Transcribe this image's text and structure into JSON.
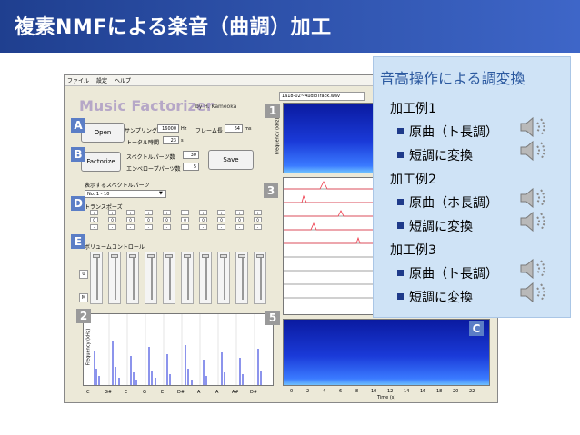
{
  "slide_title": "複素NMFによる楽音（曲調）加工",
  "app": {
    "menu": [
      "ファイル",
      "設定",
      "ヘルプ"
    ],
    "title": "Music Factorizer",
    "author": "by H. Kameoka",
    "file_name": "1a18-02~AudioTrack.wav",
    "open_label": "Open",
    "factorize_label": "Factorize",
    "save_label": "Save",
    "sampling_label": "サンプリング",
    "sampling_value": "16000",
    "sampling_unit": "Hz",
    "frame_label": "フレーム長",
    "frame_value": "64",
    "frame_unit": "ms",
    "total_time_label": "トータル時間",
    "total_time_value": "23",
    "total_time_unit": "s",
    "spectral_parts_label": "スペクトルパーツ数",
    "spectral_parts_value": "30",
    "envelope_parts_label": "エンベロープパーツ数",
    "envelope_parts_value": "5",
    "display_label": "表示するスペクトルパーツ",
    "display_select": "No. 1 - 10",
    "transpose_label": "トランスポーズ",
    "volume_label": "ボリュームコントロール",
    "transpose_values": [
      "0",
      "0",
      "0",
      "0",
      "0",
      "0",
      "0",
      "0",
      "0",
      "0"
    ],
    "left_btn_0": "0",
    "left_btn_m": "M",
    "note_labels": [
      "C",
      "G#",
      "E",
      "G",
      "E",
      "D#",
      "A",
      "A",
      "A#",
      "D#"
    ],
    "freq_axis_label": "Frequency (kHz)",
    "time_axis_label": "Time (s)",
    "time_ticks": [
      "0",
      "2",
      "4",
      "6",
      "8",
      "10",
      "12",
      "14",
      "16",
      "18",
      "20",
      "22"
    ]
  },
  "badges": [
    "A",
    "B",
    "D",
    "E",
    "1",
    "2",
    "3",
    "5",
    "C"
  ],
  "overlay": {
    "heading": "音高操作による調変換",
    "examples": [
      {
        "title": "加工例1",
        "items": [
          "原曲（ト長調）",
          "短調に変換"
        ]
      },
      {
        "title": "加工例2",
        "items": [
          "原曲（ホ長調）",
          "短調に変換"
        ]
      },
      {
        "title": "加工例3",
        "items": [
          "原曲（ト長調）",
          "短調に変換"
        ]
      }
    ],
    "speaker_icon": "speaker-icon"
  },
  "colors": {
    "title_bar_start": "#1f3f8f",
    "title_bar_end": "#3e66c8",
    "overlay_bg": "#cfe3f6",
    "overlay_heading": "#2c5aa0",
    "badge_blue": "#5b7ec6",
    "badge_grey": "#9a9a9a"
  }
}
